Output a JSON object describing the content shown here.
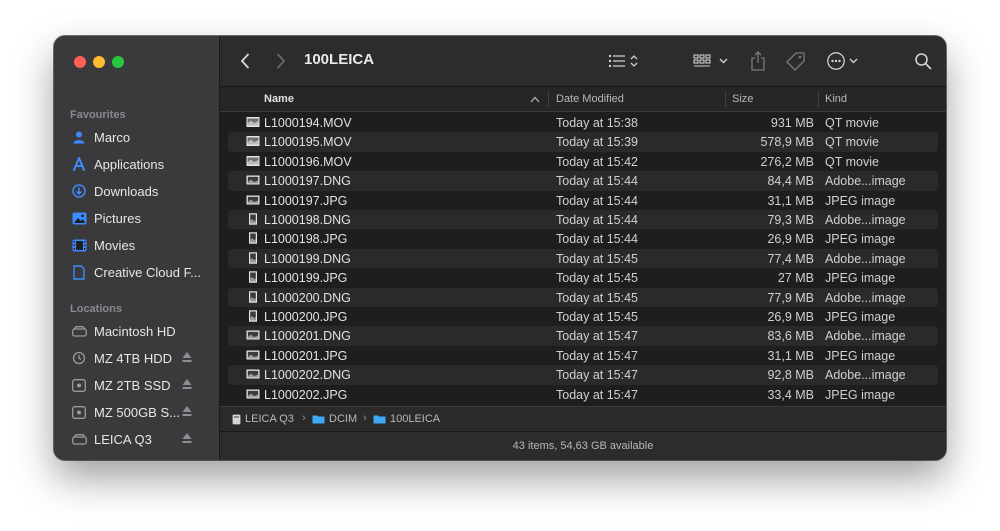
{
  "window": {
    "title": "100LEICA"
  },
  "sidebar": {
    "favourites_heading": "Favourites",
    "favourites": [
      {
        "label": "Marco",
        "icon": "home-icon"
      },
      {
        "label": "Applications",
        "icon": "applications-icon"
      },
      {
        "label": "Downloads",
        "icon": "downloads-icon"
      },
      {
        "label": "Pictures",
        "icon": "pictures-icon"
      },
      {
        "label": "Movies",
        "icon": "movies-icon"
      },
      {
        "label": "Creative Cloud F...",
        "icon": "document-icon"
      }
    ],
    "locations_heading": "Locations",
    "locations": [
      {
        "label": "Macintosh HD",
        "icon": "drive-icon",
        "eject": false
      },
      {
        "label": "MZ 4TB HDD",
        "icon": "time-machine-icon",
        "eject": true
      },
      {
        "label": "MZ 2TB SSD",
        "icon": "external-drive-icon",
        "eject": true
      },
      {
        "label": "MZ 500GB S...",
        "icon": "external-drive-icon",
        "eject": true
      },
      {
        "label": "LEICA Q3",
        "icon": "drive-icon",
        "eject": true
      }
    ]
  },
  "columns": {
    "name": "Name",
    "date": "Date Modified",
    "size": "Size",
    "kind": "Kind"
  },
  "files": [
    {
      "name": "L1000194.MOV",
      "date": "Today at 15:38",
      "size": "931 MB",
      "kind": "QT movie",
      "icon": "movie-file-icon"
    },
    {
      "name": "L1000195.MOV",
      "date": "Today at 15:39",
      "size": "578,9 MB",
      "kind": "QT movie",
      "icon": "movie-file-icon"
    },
    {
      "name": "L1000196.MOV",
      "date": "Today at 15:42",
      "size": "276,2 MB",
      "kind": "QT movie",
      "icon": "movie-file-icon"
    },
    {
      "name": "L1000197.DNG",
      "date": "Today at 15:44",
      "size": "84,4 MB",
      "kind": "Adobe...image",
      "icon": "landscape-image-icon"
    },
    {
      "name": "L1000197.JPG",
      "date": "Today at 15:44",
      "size": "31,1 MB",
      "kind": "JPEG image",
      "icon": "landscape-image-icon"
    },
    {
      "name": "L1000198.DNG",
      "date": "Today at 15:44",
      "size": "79,3 MB",
      "kind": "Adobe...image",
      "icon": "portrait-image-icon"
    },
    {
      "name": "L1000198.JPG",
      "date": "Today at 15:44",
      "size": "26,9 MB",
      "kind": "JPEG image",
      "icon": "portrait-image-icon"
    },
    {
      "name": "L1000199.DNG",
      "date": "Today at 15:45",
      "size": "77,4 MB",
      "kind": "Adobe...image",
      "icon": "portrait-image-icon"
    },
    {
      "name": "L1000199.JPG",
      "date": "Today at 15:45",
      "size": "27 MB",
      "kind": "JPEG image",
      "icon": "portrait-image-icon"
    },
    {
      "name": "L1000200.DNG",
      "date": "Today at 15:45",
      "size": "77,9 MB",
      "kind": "Adobe...image",
      "icon": "portrait-image-icon"
    },
    {
      "name": "L1000200.JPG",
      "date": "Today at 15:45",
      "size": "26,9 MB",
      "kind": "JPEG image",
      "icon": "portrait-image-icon"
    },
    {
      "name": "L1000201.DNG",
      "date": "Today at 15:47",
      "size": "83,6 MB",
      "kind": "Adobe...image",
      "icon": "landscape-image-icon"
    },
    {
      "name": "L1000201.JPG",
      "date": "Today at 15:47",
      "size": "31,1 MB",
      "kind": "JPEG image",
      "icon": "landscape-image-icon"
    },
    {
      "name": "L1000202.DNG",
      "date": "Today at 15:47",
      "size": "92,8 MB",
      "kind": "Adobe...image",
      "icon": "landscape-image-icon"
    },
    {
      "name": "L1000202.JPG",
      "date": "Today at 15:47",
      "size": "33,4 MB",
      "kind": "JPEG image",
      "icon": "landscape-image-icon"
    }
  ],
  "pathbar": [
    {
      "label": "LEICA Q3",
      "icon": "drive-icon"
    },
    {
      "label": "DCIM",
      "icon": "folder-icon"
    },
    {
      "label": "100LEICA",
      "icon": "folder-icon"
    }
  ],
  "status": {
    "text": "43 items, 54,63 GB available"
  },
  "colors": {
    "accent": "#3d8bff",
    "window_bg": "#1f1f1f",
    "sidebar_bg": "#3a3a3c"
  }
}
